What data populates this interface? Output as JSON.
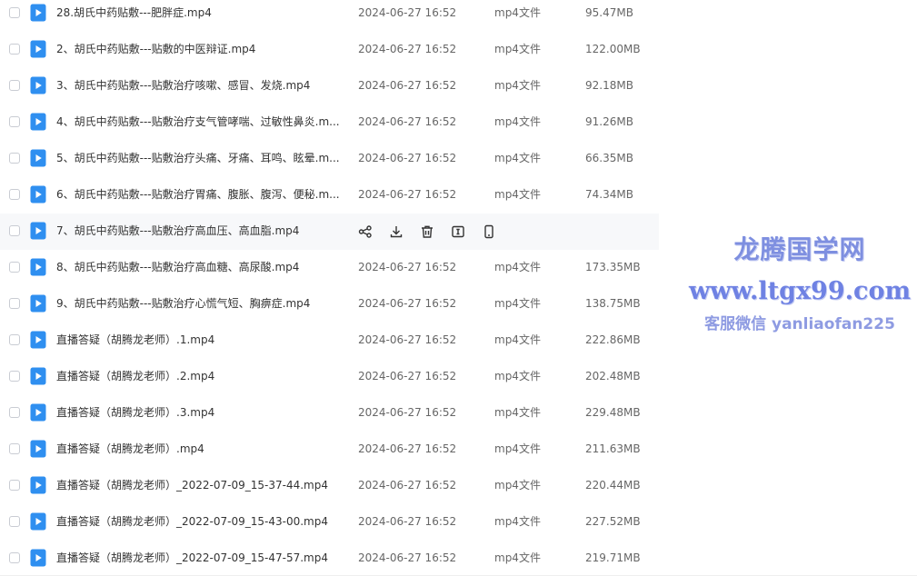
{
  "file_list": {
    "rows": [
      {
        "name": "28.胡氏中药贴敷---肥胖症.mp4",
        "date": "2024-06-27 16:52",
        "type": "mp4文件",
        "size": "95.47MB",
        "hover": false
      },
      {
        "name": "2、胡氏中药贴敷---贴敷的中医辩证.mp4",
        "date": "2024-06-27 16:52",
        "type": "mp4文件",
        "size": "122.00MB",
        "hover": false
      },
      {
        "name": "3、胡氏中药贴敷---贴敷治疗咳嗽、感冒、发烧.mp4",
        "date": "2024-06-27 16:52",
        "type": "mp4文件",
        "size": "92.18MB",
        "hover": false
      },
      {
        "name": "4、胡氏中药贴敷---贴敷治疗支气管哮喘、过敏性鼻炎.m...",
        "date": "2024-06-27 16:52",
        "type": "mp4文件",
        "size": "91.26MB",
        "hover": false
      },
      {
        "name": "5、胡氏中药贴敷---贴敷治疗头痛、牙痛、耳鸣、眩晕.m...",
        "date": "2024-06-27 16:52",
        "type": "mp4文件",
        "size": "66.35MB",
        "hover": false
      },
      {
        "name": "6、胡氏中药贴敷---贴敷治疗胃痛、腹胀、腹泻、便秘.m...",
        "date": "2024-06-27 16:52",
        "type": "mp4文件",
        "size": "74.34MB",
        "hover": false
      },
      {
        "name": "7、胡氏中药贴敷---贴敷治疗高血压、高血脂.mp4",
        "date": "",
        "type": "",
        "size": "",
        "hover": true
      },
      {
        "name": "8、胡氏中药贴敷---贴敷治疗高血糖、高尿酸.mp4",
        "date": "2024-06-27 16:52",
        "type": "mp4文件",
        "size": "173.35MB",
        "hover": false
      },
      {
        "name": "9、胡氏中药贴敷---贴敷治疗心慌气短、胸痹症.mp4",
        "date": "2024-06-27 16:52",
        "type": "mp4文件",
        "size": "138.75MB",
        "hover": false
      },
      {
        "name": "直播答疑（胡腾龙老师）.1.mp4",
        "date": "2024-06-27 16:52",
        "type": "mp4文件",
        "size": "222.86MB",
        "hover": false
      },
      {
        "name": "直播答疑（胡腾龙老师）.2.mp4",
        "date": "2024-06-27 16:52",
        "type": "mp4文件",
        "size": "202.48MB",
        "hover": false
      },
      {
        "name": "直播答疑（胡腾龙老师）.3.mp4",
        "date": "2024-06-27 16:52",
        "type": "mp4文件",
        "size": "229.48MB",
        "hover": false
      },
      {
        "name": "直播答疑（胡腾龙老师）.mp4",
        "date": "2024-06-27 16:52",
        "type": "mp4文件",
        "size": "211.63MB",
        "hover": false
      },
      {
        "name": "直播答疑（胡腾龙老师）_2022-07-09_15-37-44.mp4",
        "date": "2024-06-27 16:52",
        "type": "mp4文件",
        "size": "220.44MB",
        "hover": false
      },
      {
        "name": "直播答疑（胡腾龙老师）_2022-07-09_15-43-00.mp4",
        "date": "2024-06-27 16:52",
        "type": "mp4文件",
        "size": "227.52MB",
        "hover": false
      },
      {
        "name": "直播答疑（胡腾龙老师）_2022-07-09_15-47-57.mp4",
        "date": "2024-06-27 16:52",
        "type": "mp4文件",
        "size": "219.71MB",
        "hover": false
      }
    ],
    "hover_actions": [
      "share-icon",
      "download-icon",
      "delete-icon",
      "rename-icon",
      "phone-icon"
    ]
  },
  "watermark": {
    "title": "龙腾国学网",
    "url": "www.ltgx99.com",
    "contact": "客服微信 yanliaofan225"
  },
  "colors": {
    "icon_blue": "#2f8ff0",
    "hover_bg": "#f7f8fa",
    "watermark": "#7e8fe0"
  }
}
